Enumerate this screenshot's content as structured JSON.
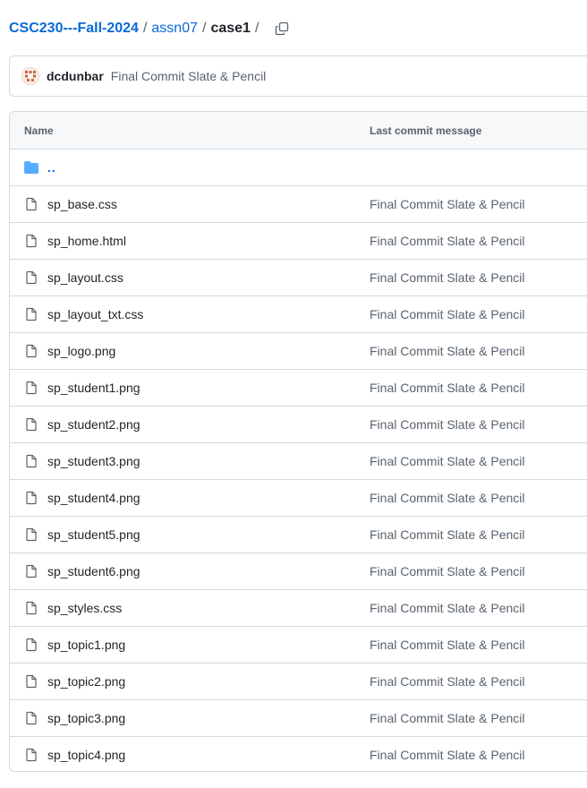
{
  "breadcrumb": {
    "repo": "CSC230---Fall-2024",
    "sep": "/",
    "folder": "assn07",
    "current": "case1",
    "trailing_sep": "/"
  },
  "commit": {
    "author": "dcdunbar",
    "message": "Final Commit Slate & Pencil"
  },
  "table": {
    "headers": {
      "name": "Name",
      "message": "Last commit message"
    },
    "parent_link": "..",
    "files": [
      {
        "name": "sp_base.css",
        "message": "Final Commit Slate & Pencil"
      },
      {
        "name": "sp_home.html",
        "message": "Final Commit Slate & Pencil"
      },
      {
        "name": "sp_layout.css",
        "message": "Final Commit Slate & Pencil"
      },
      {
        "name": "sp_layout_txt.css",
        "message": "Final Commit Slate & Pencil"
      },
      {
        "name": "sp_logo.png",
        "message": "Final Commit Slate & Pencil"
      },
      {
        "name": "sp_student1.png",
        "message": "Final Commit Slate & Pencil"
      },
      {
        "name": "sp_student2.png",
        "message": "Final Commit Slate & Pencil"
      },
      {
        "name": "sp_student3.png",
        "message": "Final Commit Slate & Pencil"
      },
      {
        "name": "sp_student4.png",
        "message": "Final Commit Slate & Pencil"
      },
      {
        "name": "sp_student5.png",
        "message": "Final Commit Slate & Pencil"
      },
      {
        "name": "sp_student6.png",
        "message": "Final Commit Slate & Pencil"
      },
      {
        "name": "sp_styles.css",
        "message": "Final Commit Slate & Pencil"
      },
      {
        "name": "sp_topic1.png",
        "message": "Final Commit Slate & Pencil"
      },
      {
        "name": "sp_topic2.png",
        "message": "Final Commit Slate & Pencil"
      },
      {
        "name": "sp_topic3.png",
        "message": "Final Commit Slate & Pencil"
      },
      {
        "name": "sp_topic4.png",
        "message": "Final Commit Slate & Pencil"
      }
    ]
  },
  "icons": {
    "file": "file-icon",
    "folder": "folder-icon",
    "copy": "copy-icon"
  },
  "colors": {
    "link": "#0969da",
    "folder": "#54aeff",
    "muted": "#59636e",
    "border": "#d1d9e0",
    "header_bg": "#f6f8fa"
  }
}
